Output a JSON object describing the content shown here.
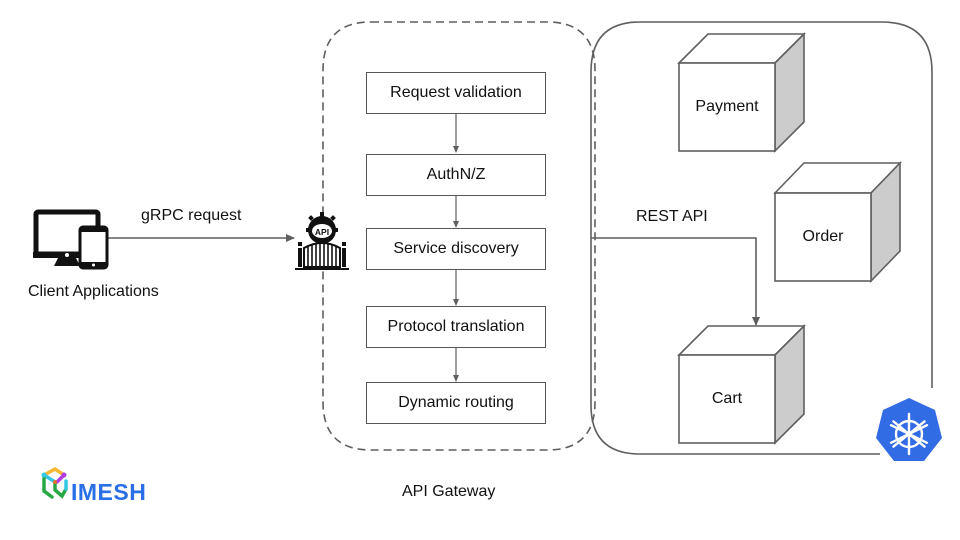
{
  "client": {
    "label": "Client Applications",
    "icon": "desktop-mobile-icon"
  },
  "connection_labels": {
    "grpc": "gRPC request",
    "rest": "REST API"
  },
  "gateway": {
    "label": "API Gateway",
    "icon": "api-gateway-icon",
    "steps": [
      {
        "label": "Request validation"
      },
      {
        "label": "AuthN/Z"
      },
      {
        "label": "Service discovery"
      },
      {
        "label": "Protocol translation"
      },
      {
        "label": "Dynamic routing"
      }
    ]
  },
  "cluster": {
    "icon": "kubernetes-icon",
    "services": [
      {
        "label": "Payment"
      },
      {
        "label": "Order"
      },
      {
        "label": "Cart"
      }
    ]
  },
  "brand": {
    "name": "IMESH",
    "color": "#2b6fe6"
  },
  "colors": {
    "line": "#5f5f5f",
    "cube_side": "#cccccc",
    "kubernetes": "#326ce5"
  }
}
